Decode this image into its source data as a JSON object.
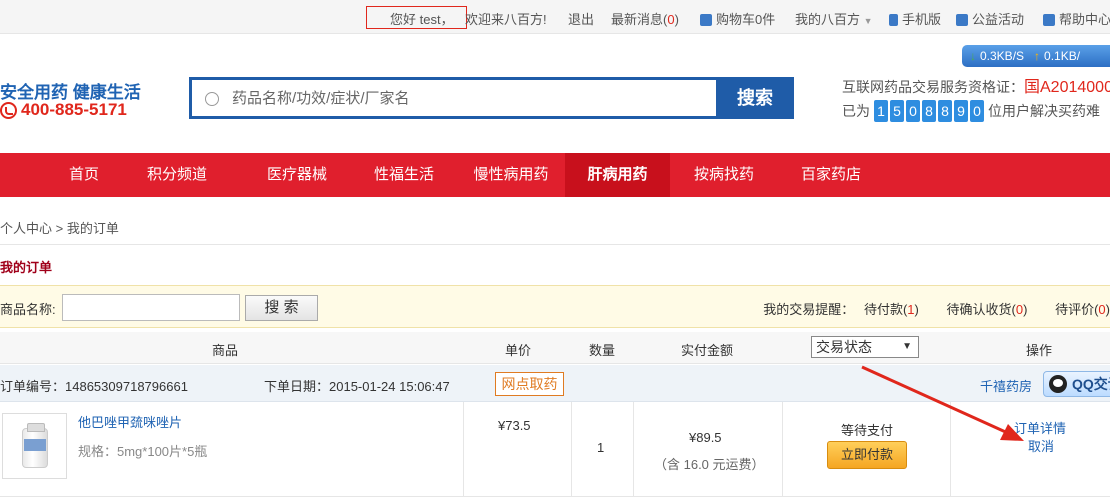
{
  "topbar": {
    "greeting": "您好 test，",
    "welcome": "欢迎来八百方!",
    "logout": "退出",
    "news_label": "最新消息(",
    "news_count": "0",
    "news_close": ")",
    "cart": "购物车0件",
    "my_account": "我的八百方",
    "mobile": "手机版",
    "charity": "公益活动",
    "help": "帮助中心"
  },
  "header": {
    "slogan": "安全用药 健康生活",
    "hotline": "400-885-5171",
    "search_placeholder": "药品名称/功效/症状/厂家名",
    "search_button": "搜索",
    "speed_down": "0.3KB/S",
    "speed_up": "0.1KB/",
    "license_label": "互联网药品交易服务资格证：",
    "license_num": "国A2014000",
    "counter_prefix": "已为",
    "counter_digits": [
      "1",
      "5",
      "0",
      "8",
      "8",
      "9",
      "0"
    ],
    "counter_suffix": "位用户解决买药难"
  },
  "nav": {
    "items": [
      {
        "label": "首页"
      },
      {
        "label": "积分频道"
      },
      {
        "label": "医疗器械"
      },
      {
        "label": "性福生活"
      },
      {
        "label": "慢性病用药"
      },
      {
        "label": "肝病用药"
      },
      {
        "label": "按病找药"
      },
      {
        "label": "百家药店"
      }
    ],
    "active": "肝病用药"
  },
  "breadcrumb": "个人中心 > 我的订单",
  "page_title": "我的订单",
  "filter": {
    "label": "商品名称:",
    "value": "",
    "button": "搜 索",
    "reminder_label": "我的交易提醒：",
    "reminders": [
      {
        "label": "待付款",
        "count": "1"
      },
      {
        "label": "待确认收货",
        "count": "0"
      },
      {
        "label": "待评价",
        "count": "0"
      }
    ]
  },
  "table": {
    "headers": {
      "product": "商品",
      "unit_price": "单价",
      "quantity": "数量",
      "paid": "实付金额",
      "status": "交易状态",
      "action": "操作"
    }
  },
  "order": {
    "number_label": "订单编号：",
    "number": "14865309718796661",
    "date_label": "下单日期：",
    "date": "2015-01-24 15:06:47",
    "badge": "网点取药",
    "store": "千禧药房",
    "qq_label": "QQ交谈",
    "product_name": "他巴唑甲巯咪唑片",
    "spec": "规格：5mg*100片*5瓶",
    "unit_price": "¥73.5",
    "quantity": "1",
    "total": "¥89.5",
    "shipping": "（含 16.0 元运费）",
    "status": "等待支付",
    "pay_button": "立即付款",
    "detail_link": "订单详情",
    "cancel_link": "取消"
  },
  "colors": {
    "brand_blue": "#1f5ca8",
    "nav_red": "#e01f2d",
    "alert_red": "#e0271c",
    "pay_orange": "#f5a623"
  }
}
